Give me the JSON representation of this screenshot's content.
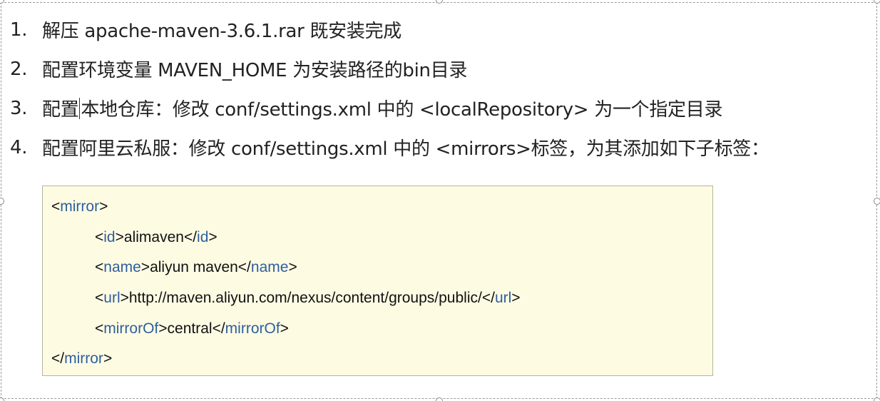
{
  "steps": [
    {
      "num": "1.",
      "text": "解压 apache-maven-3.6.1.rar 既安装完成"
    },
    {
      "num": "2.",
      "text": "配置环境变量 MAVEN_HOME 为安装路径的bin目录"
    },
    {
      "num": "3.",
      "text_before_cursor": "配置",
      "text_after_cursor": "本地仓库：修改 conf/settings.xml 中的 <localRepository> 为一个指定目录"
    },
    {
      "num": "4.",
      "text": "配置阿里云私服：修改 conf/settings.xml 中的 <mirrors>标签，为其添加如下子标签："
    }
  ],
  "code": {
    "open_mirror": "mirror",
    "id_tag": "id",
    "id_value": "alimaven",
    "name_tag": "name",
    "name_value": "aliyun maven",
    "url_tag": "url",
    "url_value": "http://maven.aliyun.com/nexus/content/groups/public/",
    "mirrorof_tag": "mirrorOf",
    "mirrorof_value": "central",
    "close_mirror": "mirror"
  },
  "colors": {
    "code_background": "#fefbe3",
    "tag_name": "#2e5f9e"
  }
}
